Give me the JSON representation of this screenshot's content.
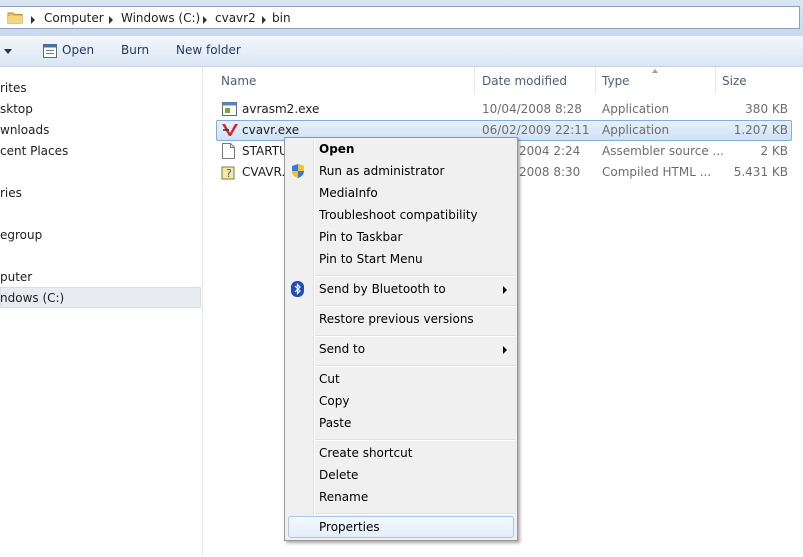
{
  "address": {
    "crumbs": [
      "Computer",
      "Windows (C:)",
      "cvavr2",
      "bin"
    ]
  },
  "toolbar": {
    "open_label": "Open",
    "burn_label": "Burn",
    "new_folder_label": "New folder"
  },
  "nav": {
    "items": [
      "rites",
      "sktop",
      "wnloads",
      "cent Places",
      "ries",
      "egroup",
      "puter",
      "ndows (C:)"
    ]
  },
  "columns": {
    "name": "Name",
    "date": "Date modified",
    "type": "Type",
    "size": "Size"
  },
  "files": [
    {
      "name": "avrasm2.exe",
      "date": "10/04/2008 8:28",
      "type": "Application",
      "size": "380 KB"
    },
    {
      "name": "cvavr.exe",
      "date": "06/02/2009 22:11",
      "type": "Application",
      "size": "1.207 KB"
    },
    {
      "name": "STARTU",
      "date": "2004 2:24",
      "type": "Assembler source ...",
      "size": "2 KB"
    },
    {
      "name": "CVAVR.C",
      "date": "2008 8:30",
      "type": "Compiled HTML ...",
      "size": "5.431 KB"
    }
  ],
  "context_menu": {
    "open": "Open",
    "run_as_admin": "Run as administrator",
    "mediainfo": "MediaInfo",
    "troubleshoot": "Troubleshoot compatibility",
    "pin_taskbar": "Pin to Taskbar",
    "pin_start": "Pin to Start Menu",
    "bluetooth": "Send by Bluetooth to",
    "restore": "Restore previous versions",
    "send_to": "Send to",
    "cut": "Cut",
    "copy": "Copy",
    "paste": "Paste",
    "create_shortcut": "Create shortcut",
    "delete": "Delete",
    "rename": "Rename",
    "properties": "Properties"
  },
  "colors": {
    "selection_border": "#84acdd",
    "menu_bg": "#f0f0f0",
    "toolbar_text": "#1e395b"
  }
}
